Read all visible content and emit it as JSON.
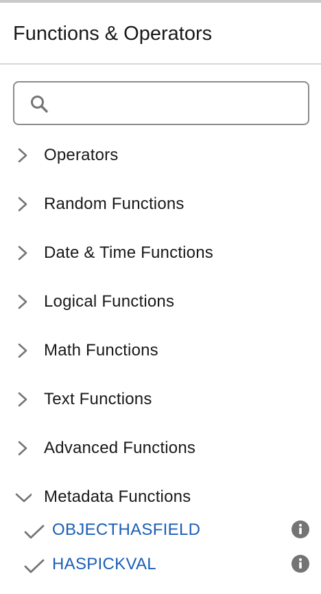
{
  "panel": {
    "title": "Functions & Operators"
  },
  "search": {
    "value": "",
    "placeholder": ""
  },
  "categories": [
    {
      "label": "Operators",
      "expanded": false
    },
    {
      "label": "Random Functions",
      "expanded": false
    },
    {
      "label": "Date & Time Functions",
      "expanded": false
    },
    {
      "label": "Logical Functions",
      "expanded": false
    },
    {
      "label": "Math Functions",
      "expanded": false
    },
    {
      "label": "Text Functions",
      "expanded": false
    },
    {
      "label": "Advanced Functions",
      "expanded": false
    },
    {
      "label": "Metadata Functions",
      "expanded": true
    }
  ],
  "metadata_functions": [
    {
      "name": "OBJECTHASFIELD",
      "selected": true
    },
    {
      "name": "HASPICKVAL",
      "selected": true
    }
  ],
  "colors": {
    "link": "#1b5eb5",
    "icon": "#747474",
    "text": "#181818",
    "border": "#8a8a8a"
  },
  "icons": {
    "search": "search-icon",
    "collapsed": "chevron-right-icon",
    "expanded": "chevron-down-icon",
    "selected": "check-icon",
    "info": "info-icon"
  }
}
